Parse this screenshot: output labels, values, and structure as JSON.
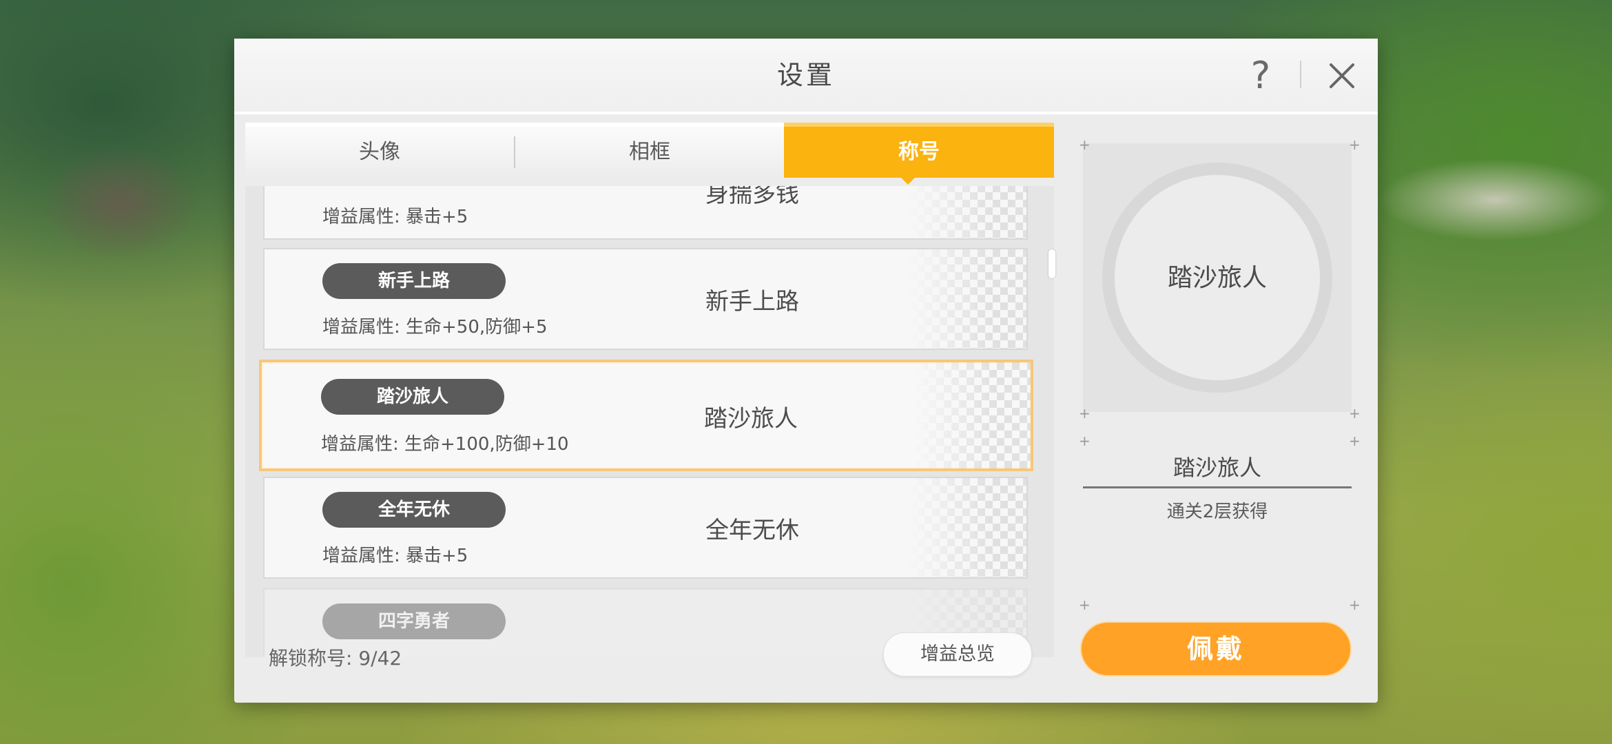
{
  "dialog": {
    "title": "设置",
    "help_icon_glyph": "?"
  },
  "tabs": [
    {
      "label": "头像",
      "active": false
    },
    {
      "label": "相框",
      "active": false
    },
    {
      "label": "称号",
      "active": true
    }
  ],
  "titles": [
    {
      "pill": "",
      "name": "身揣多钱",
      "bonus": "增益属性: 暴击+5"
    },
    {
      "pill": "新手上路",
      "name": "新手上路",
      "bonus": "增益属性: 生命+50,防御+5"
    },
    {
      "pill": "踏沙旅人",
      "name": "踏沙旅人",
      "bonus": "增益属性: 生命+100,防御+10",
      "selected": true
    },
    {
      "pill": "全年无休",
      "name": "全年无休",
      "bonus": "增益属性: 暴击+5"
    },
    {
      "pill": "四字勇者",
      "name": "",
      "bonus": ""
    }
  ],
  "footer": {
    "unlock_label": "解锁称号: 9/42",
    "overview_button": "增益总览"
  },
  "preview": {
    "name": "踏沙旅人"
  },
  "info": {
    "title": "踏沙旅人",
    "description": "通关2层获得"
  },
  "actions": {
    "wear_button": "佩戴"
  },
  "colors": {
    "accent_tab": "#fbb310",
    "wear_button": "#ffa225",
    "pill": "#5b5b5b",
    "selected_border": "#f6c77a"
  }
}
